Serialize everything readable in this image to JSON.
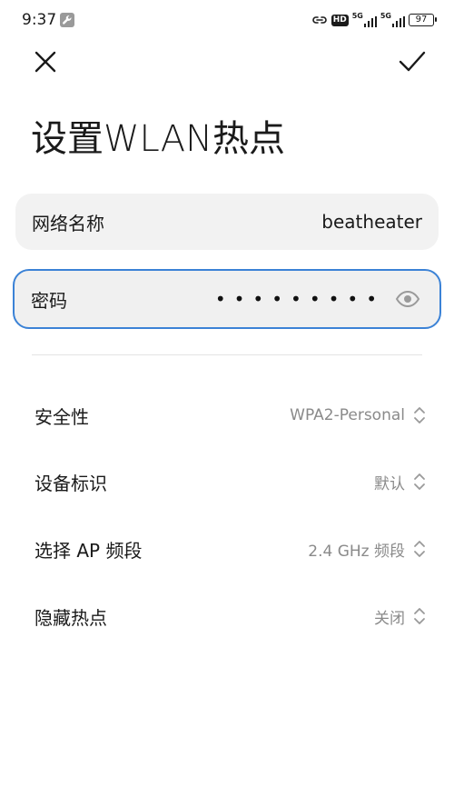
{
  "status_bar": {
    "time": "9:37",
    "notification_icon": "wrench-icon",
    "hd_label": "HD",
    "network_1": "5G",
    "network_2": "5G",
    "battery": "97"
  },
  "header": {
    "close_icon": "close-icon",
    "confirm_icon": "check-icon",
    "title": "设置WLAN热点"
  },
  "fields": {
    "ssid": {
      "label": "网络名称",
      "value": "beatheater"
    },
    "password": {
      "label": "密码",
      "masked_value": "•••••••••",
      "toggle_icon": "eye-icon"
    }
  },
  "settings": [
    {
      "label": "安全性",
      "value": "WPA2-Personal"
    },
    {
      "label": "设备标识",
      "value": "默认"
    },
    {
      "label": "选择 AP 频段",
      "value": "2.4 GHz 频段"
    },
    {
      "label": "隐藏热点",
      "value": "关闭"
    }
  ],
  "colors": {
    "accent": "#3b82d6",
    "field_bg": "#f2f2f2",
    "secondary_text": "#8a8a8a"
  }
}
